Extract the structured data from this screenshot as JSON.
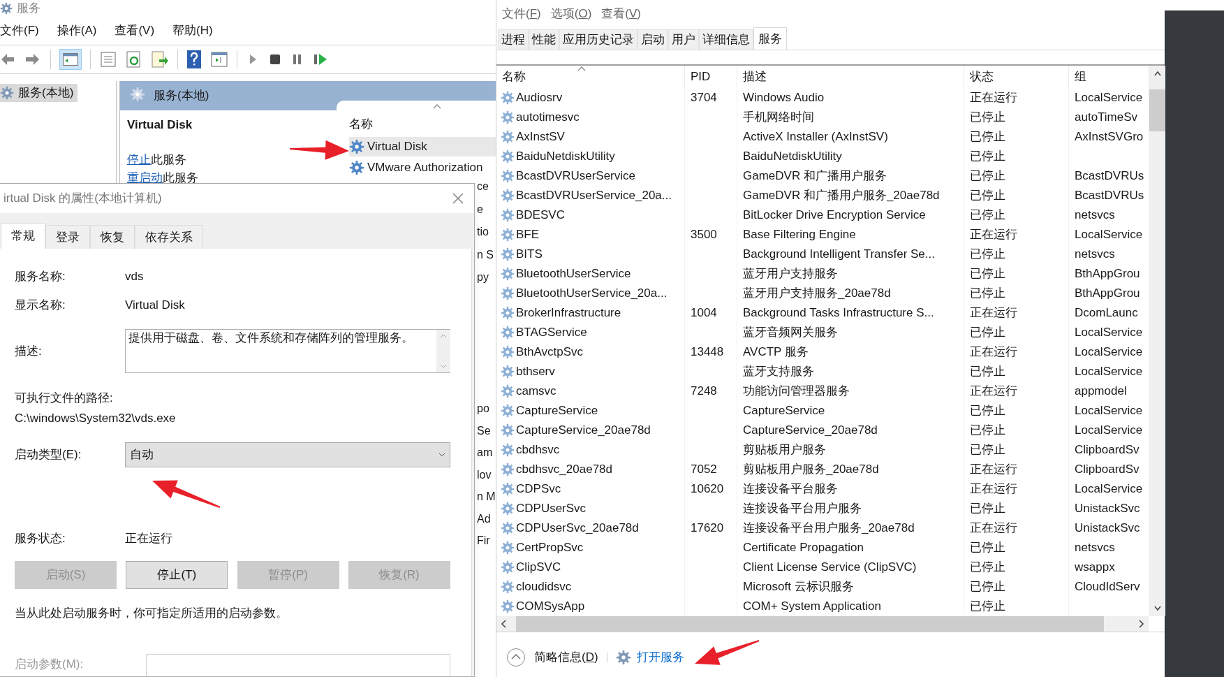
{
  "services_window": {
    "title": "服务",
    "menu": [
      "文件(F)",
      "操作(A)",
      "查看(V)",
      "帮助(H)"
    ],
    "tree": [
      {
        "label": "服务(本地)",
        "selected": true
      }
    ],
    "header": "服务(本地)",
    "detail_title": "Virtual Disk",
    "actions": [
      {
        "link": "停止",
        "text": "此服务"
      },
      {
        "link": "重启动",
        "text": "此服务"
      }
    ],
    "list": {
      "column": "名称",
      "items": [
        {
          "name": "Virtual Disk",
          "selected": true
        },
        {
          "name": "VMware Authorization",
          "selected": false
        }
      ]
    },
    "fragments_upper": [
      "ce",
      "e",
      "tio",
      "n S",
      "py"
    ],
    "fragments_lower": [
      "po",
      "Se",
      "am",
      "lov",
      "n M",
      "Ad",
      "Fir"
    ]
  },
  "properties_dialog": {
    "title": "irtual Disk 的属性(本地计算机)",
    "tabs": [
      {
        "label": "常规",
        "selected": true
      },
      {
        "label": "登录",
        "selected": false
      },
      {
        "label": "恢复",
        "selected": false
      },
      {
        "label": "依存关系",
        "selected": false
      }
    ],
    "fields": [
      {
        "label": "服务名称:",
        "value": "vds"
      },
      {
        "label": "显示名称:",
        "value": "Virtual Disk"
      }
    ],
    "description": {
      "label": "描述:",
      "value": "提供用于磁盘、卷、文件系统和存储阵列的管理服务。"
    },
    "path": {
      "label": "可执行文件的路径:",
      "value": "C:\\windows\\System32\\vds.exe"
    },
    "startup_type": {
      "label": "启动类型(E):",
      "value": "自动"
    },
    "service_status": {
      "label": "服务状态:",
      "value": "正在运行"
    },
    "buttons": [
      {
        "label": "启动(S)",
        "disabled": true
      },
      {
        "label": "停止(T)",
        "disabled": false
      },
      {
        "label": "暂停(P)",
        "disabled": true
      },
      {
        "label": "恢复(R)",
        "disabled": true
      }
    ],
    "hint": "当从此处启动服务时，你可指定所适用的启动参数。",
    "start_params": {
      "label": "启动参数(M):"
    }
  },
  "task_manager": {
    "menu": [
      "文件(F)",
      "选项(O)",
      "查看(V)"
    ],
    "tabs": [
      {
        "label": "进程",
        "selected": false
      },
      {
        "label": "性能",
        "selected": false
      },
      {
        "label": "应用历史记录",
        "selected": false
      },
      {
        "label": "启动",
        "selected": false
      },
      {
        "label": "用户",
        "selected": false
      },
      {
        "label": "详细信息",
        "selected": false
      },
      {
        "label": "服务",
        "selected": true
      }
    ],
    "columns": [
      "名称",
      "PID",
      "描述",
      "状态",
      "组"
    ],
    "rows": [
      {
        "name": "Audiosrv",
        "pid": "3704",
        "description": "Windows Audio",
        "status": "正在运行",
        "group": "LocalService"
      },
      {
        "name": "autotimesvc",
        "description": "手机网络时间",
        "status": "已停止",
        "group": "autoTimeSv"
      },
      {
        "name": "AxInstSV",
        "description": "ActiveX Installer (AxInstSV)",
        "status": "已停止",
        "group": "AxInstSVGro"
      },
      {
        "name": "BaiduNetdiskUtility",
        "description": "BaiduNetdiskUtility",
        "status": "已停止"
      },
      {
        "name": "BcastDVRUserService",
        "description": "GameDVR 和广播用户服务",
        "status": "已停止",
        "group": "BcastDVRUs"
      },
      {
        "name": "BcastDVRUserService_20a...",
        "description": "GameDVR 和广播用户服务_20ae78d",
        "status": "已停止",
        "group": "BcastDVRUs"
      },
      {
        "name": "BDESVC",
        "description": "BitLocker Drive Encryption Service",
        "status": "已停止",
        "group": "netsvcs"
      },
      {
        "name": "BFE",
        "pid": "3500",
        "description": "Base Filtering Engine",
        "status": "正在运行",
        "group": "LocalService"
      },
      {
        "name": "BITS",
        "description": "Background Intelligent Transfer Se...",
        "status": "已停止",
        "group": "netsvcs"
      },
      {
        "name": "BluetoothUserService",
        "description": "蓝牙用户支持服务",
        "status": "已停止",
        "group": "BthAppGrou"
      },
      {
        "name": "BluetoothUserService_20a...",
        "description": "蓝牙用户支持服务_20ae78d",
        "status": "已停止",
        "group": "BthAppGrou"
      },
      {
        "name": "BrokerInfrastructure",
        "pid": "1004",
        "description": "Background Tasks Infrastructure S...",
        "status": "正在运行",
        "group": "DcomLaunc"
      },
      {
        "name": "BTAGService",
        "description": "蓝牙音频网关服务",
        "status": "已停止",
        "group": "LocalService"
      },
      {
        "name": "BthAvctpSvc",
        "pid": "13448",
        "description": "AVCTP 服务",
        "status": "正在运行",
        "group": "LocalService"
      },
      {
        "name": "bthserv",
        "description": "蓝牙支持服务",
        "status": "已停止",
        "group": "LocalService"
      },
      {
        "name": "camsvc",
        "pid": "7248",
        "description": "功能访问管理器服务",
        "status": "正在运行",
        "group": "appmodel"
      },
      {
        "name": "CaptureService",
        "description": "CaptureService",
        "status": "已停止",
        "group": "LocalService"
      },
      {
        "name": "CaptureService_20ae78d",
        "description": "CaptureService_20ae78d",
        "status": "已停止",
        "group": "LocalService"
      },
      {
        "name": "cbdhsvc",
        "description": "剪贴板用户服务",
        "status": "已停止",
        "group": "ClipboardSv"
      },
      {
        "name": "cbdhsvc_20ae78d",
        "pid": "7052",
        "description": "剪贴板用户服务_20ae78d",
        "status": "正在运行",
        "group": "ClipboardSv"
      },
      {
        "name": "CDPSvc",
        "pid": "10620",
        "description": "连接设备平台服务",
        "status": "正在运行",
        "group": "LocalService"
      },
      {
        "name": "CDPUserSvc",
        "description": "连接设备平台用户服务",
        "status": "已停止",
        "group": "UnistackSvc"
      },
      {
        "name": "CDPUserSvc_20ae78d",
        "pid": "17620",
        "description": "连接设备平台用户服务_20ae78d",
        "status": "正在运行",
        "group": "UnistackSvc"
      },
      {
        "name": "CertPropSvc",
        "description": "Certificate Propagation",
        "status": "已停止",
        "group": "netsvcs"
      },
      {
        "name": "ClipSVC",
        "description": "Client License Service (ClipSVC)",
        "status": "已停止",
        "group": "wsappx"
      },
      {
        "name": "cloudidsvc",
        "description": "Microsoft 云标识服务",
        "status": "已停止",
        "group": "CloudIdServ"
      },
      {
        "name": "COMSysApp",
        "description": "COM+ System Application",
        "status": "已停止"
      }
    ],
    "footer": {
      "summary": "简略信息(D)",
      "open_services": "打开服务"
    }
  }
}
